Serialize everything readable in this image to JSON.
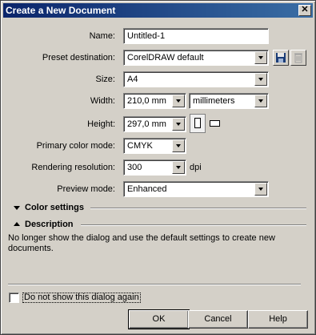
{
  "window": {
    "title": "Create a New Document",
    "close_glyph": "✕"
  },
  "form": {
    "name": {
      "label": "Name:",
      "value": "Untitled-1"
    },
    "preset": {
      "label": "Preset destination:",
      "value": "CorelDRAW default"
    },
    "size": {
      "label": "Size:",
      "value": "A4"
    },
    "width": {
      "label": "Width:",
      "value": "210,0 mm",
      "unit": "millimeters"
    },
    "height": {
      "label": "Height:",
      "value": "297,0 mm"
    },
    "color_mode": {
      "label": "Primary color mode:",
      "value": "CMYK"
    },
    "resolution": {
      "label": "Rendering resolution:",
      "value": "300",
      "unit": "dpi"
    },
    "preview": {
      "label": "Preview mode:",
      "value": "Enhanced"
    }
  },
  "sections": {
    "color_settings": "Color settings",
    "description": "Description",
    "description_text": "No longer show the dialog and use the default settings to create new documents."
  },
  "footer": {
    "checkbox_label": "Do not show this dialog again",
    "ok": "OK",
    "cancel": "Cancel",
    "help": "Help"
  },
  "icons": [
    "save-preset-icon",
    "delete-preset-icon",
    "portrait-icon",
    "landscape-icon",
    "dropdown-arrow-icon"
  ],
  "colors": {
    "titlebar_start": "#0a246a",
    "titlebar_end": "#3a6ea5",
    "face": "#d4d0c8"
  }
}
